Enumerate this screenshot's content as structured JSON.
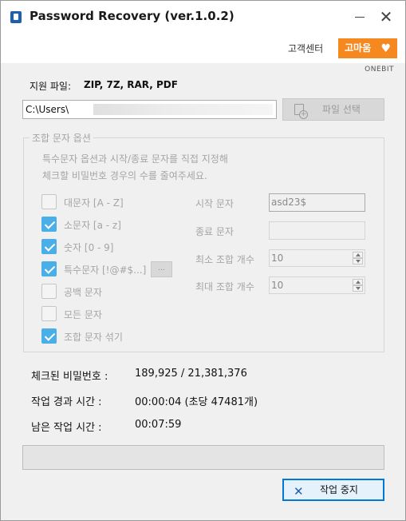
{
  "window": {
    "title": "Password Recovery (ver.1.0.2)",
    "minimize_icon": "minimize-icon",
    "close_icon": "close-icon",
    "close_glyph": "✕"
  },
  "header": {
    "support_label": "고객센터",
    "thanks_label": "고마움",
    "thanks_icon": "heart-icon",
    "heart_glyph": "♥",
    "brand": "ONEBIT",
    "accent_color": "#f5891f"
  },
  "file": {
    "supported_label": "지원 파일:",
    "supported_formats": "ZIP, 7Z, RAR, PDF",
    "path_value": "C:\\Users\\",
    "select_button_label": "파일 선택"
  },
  "options": {
    "legend": "조합 문자 옵션",
    "help_line1": "특수문자 옵션과 시작/종료 문자를 직접 지정해",
    "help_line2": "체크할 비밀번호 경우의 수를 줄여주세요.",
    "checkboxes": [
      {
        "label": "대문자 [A - Z]",
        "checked": false
      },
      {
        "label": "소문자 [a - z]",
        "checked": true
      },
      {
        "label": "숫자 [0 - 9]",
        "checked": true
      },
      {
        "label": "특수문자 [!@#$...]",
        "checked": true
      },
      {
        "label": "공백 문자",
        "checked": false
      },
      {
        "label": "모든 문자",
        "checked": false
      },
      {
        "label": "조합 문자 섞기",
        "checked": true
      }
    ],
    "special_more_label": "...",
    "start_label": "시작 문자",
    "start_value": "asd23$",
    "end_label": "종료 문자",
    "end_value": "",
    "min_label": "최소 조합 개수",
    "min_value": "10",
    "max_label": "최대 조합 개수",
    "max_value": "10",
    "check_color": "#4aaee8"
  },
  "stats": {
    "checked_label": "체크된 비밀번호 :",
    "checked_value": "189,925 / 21,381,376",
    "elapsed_label": "작업 경과 시간 :",
    "elapsed_value": "00:00:04 (초당 47481개)",
    "remaining_label": "남은 작업 시간 :",
    "remaining_value": "00:07:59"
  },
  "progress": {
    "fraction": 0.0
  },
  "actions": {
    "stop_label": "작업 중지",
    "stop_icon": "x-icon",
    "stop_glyph": "✕"
  }
}
